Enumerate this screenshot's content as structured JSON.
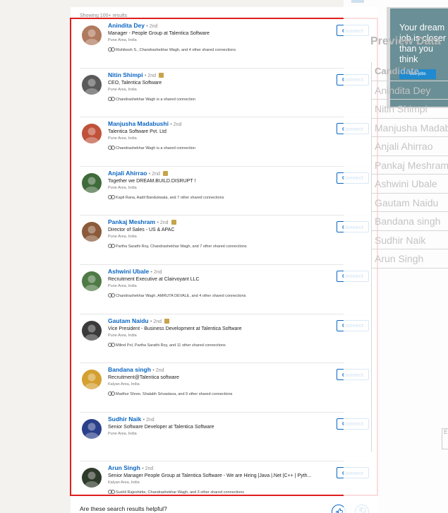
{
  "results": {
    "showing_text": "Showing 100+ results",
    "connect_label": "Connect",
    "people": [
      {
        "name": "Anindita Dey",
        "degree": "• 2nd",
        "premium": false,
        "headline": "Manager - People Group at Talentica Software",
        "location": "Pune Area, India",
        "shared": "Rishikesh S., Chandrashekhar Wagh, and 4 other shared connections",
        "avatar_color": "#b07a5e"
      },
      {
        "name": "Nitin Shimpi",
        "degree": "• 2nd",
        "premium": true,
        "headline": "CEO, Talentica Software",
        "location": "Pune Area, India",
        "shared": "Chandrashekhar Wagh is a shared connection",
        "avatar_color": "#5a5a5a"
      },
      {
        "name": "Manjusha Madabushi",
        "degree": "• 2nd",
        "premium": false,
        "headline": "Talentica Software Pvt. Ltd",
        "location": "Pune Area, India",
        "shared": "Chandrashekhar Wagh is a shared connection",
        "avatar_color": "#c0523a"
      },
      {
        "name": "Anjali Ahirrao",
        "degree": "• 2nd",
        "premium": true,
        "headline": "Together we DREAM.BUILD.DISRUPT !",
        "location": "Pune Area, India",
        "shared": "Kapil Rana, Aadil Bandukwala, and 7 other shared connections",
        "avatar_color": "#3f6a3a"
      },
      {
        "name": "Pankaj Meshram",
        "degree": "• 2nd",
        "premium": true,
        "headline": "Director of Sales - US & APAC",
        "location": "Pune Area, India",
        "shared": "Partha Sarathi Roy, Chandrashekhar Wagh, and 7 other shared connections",
        "avatar_color": "#8a5a3a"
      },
      {
        "name": "Ashwini Ubale",
        "degree": "• 2nd",
        "premium": false,
        "headline": "Recruitment Executive at Clairvoyant LLC",
        "location": "Pune Area, India",
        "shared": "Chandrashekhar Wagh, AMRUTA DEVALE, and 4 other shared connections",
        "avatar_color": "#4f7a46"
      },
      {
        "name": "Gautam Naidu",
        "degree": "• 2nd",
        "premium": true,
        "headline": "Vice President - Business Development at Talentica Software",
        "location": "Pune Area, India",
        "shared": "Milind Pol, Partha Sarathi Roy, and 11 other shared connections",
        "avatar_color": "#3a3a3a"
      },
      {
        "name": "Bandana singh",
        "degree": "• 2nd",
        "premium": false,
        "headline": "Recruitment@Talentica software",
        "location": "Kalyan Area, India",
        "shared": "Madhur Shree, Shalabh Srivastava, and 9 other shared connections",
        "avatar_color": "#d4a030"
      },
      {
        "name": "Sudhir Naik",
        "degree": "• 2nd",
        "premium": false,
        "headline": "Senior Software Developer at Talentica Software",
        "location": "Pune Area, India",
        "shared": "",
        "avatar_color": "#2a3f8a"
      },
      {
        "name": "Arun Singh",
        "degree": "• 2nd",
        "premium": false,
        "headline": "Senior Manager People Group at Talentica Software - We are Hiring |Java |.Net |C++ | Pyth...",
        "location": "Kalyan Area, India",
        "shared": "Sushil Rajeshirke, Chandrashekhar Wagh, and 3 other shared connections",
        "avatar_color": "#2e3a2a"
      }
    ]
  },
  "feedback": {
    "question": "Are these search results helpful?"
  },
  "overlay": {
    "ad_text": "Your dream job is closer than you think",
    "ad_button": "See jobs",
    "preview_title": "Preview Data",
    "column_header": "Candidate",
    "names": [
      "Anindita Dey",
      "Nitin Shimpi",
      "Manjusha Madabushi",
      "Anjali Ahirrao",
      "Pankaj Meshram",
      "Ashwini Ubale",
      "Gautam Naidu",
      "Bandana singh",
      "Sudhir Naik",
      "Arun Singh"
    ],
    "scroll_glyph": "E"
  },
  "colors": {
    "link_blue": "#0a66c2",
    "highlight_red": "#e01e1e"
  }
}
